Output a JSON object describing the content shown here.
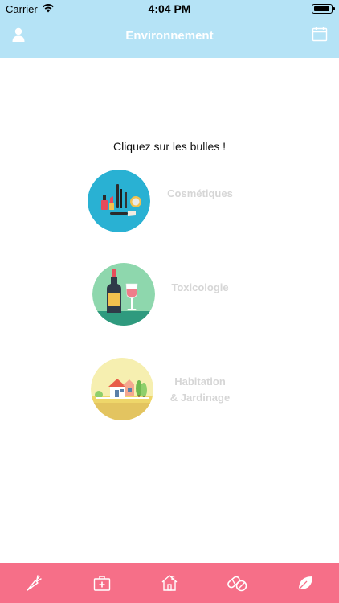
{
  "status_bar": {
    "carrier": "Carrier",
    "time": "4:04 PM"
  },
  "nav": {
    "title": "Environnement",
    "left_icon": "user-icon",
    "right_icon": "calendar-icon"
  },
  "main": {
    "prompt": "Cliquez sur les bulles !",
    "categories": [
      {
        "label": "Cosmétiques",
        "icon": "cosmetics-icon",
        "bg": "#29b1d3"
      },
      {
        "label": "Toxicologie",
        "icon": "wine-bottle-icon",
        "bg": "#8ed7ad"
      },
      {
        "label_line1": "Habitation",
        "label_line2": "& Jardinage",
        "icon": "house-garden-icon",
        "bg": "#f3eaa0"
      }
    ]
  },
  "tabbar": {
    "tabs": [
      {
        "icon": "carrot-icon"
      },
      {
        "icon": "first-aid-kit-icon"
      },
      {
        "icon": "home-icon"
      },
      {
        "icon": "pills-icon",
        "active": true
      },
      {
        "icon": "leaf-icon"
      }
    ]
  },
  "colors": {
    "header_bg": "#b5e3f6",
    "tabbar_bg": "#f66f88",
    "label_color": "#d6d6d6"
  }
}
